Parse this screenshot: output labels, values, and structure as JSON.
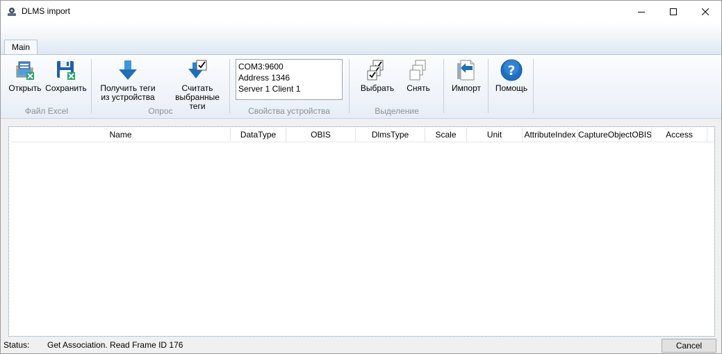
{
  "window": {
    "title": "DLMS import",
    "app_icon": "dlms-app-icon"
  },
  "tabs": [
    {
      "label": "Main",
      "active": true
    }
  ],
  "ribbon": {
    "groups": {
      "excel": {
        "label": "Файл Excel",
        "buttons": [
          {
            "label": "Открыть",
            "icon": "open-excel-icon"
          },
          {
            "label": "Сохранить",
            "icon": "save-excel-icon"
          }
        ]
      },
      "poll": {
        "label": "Опрос",
        "buttons": [
          {
            "line1": "Получить теги",
            "line2": "из устройства",
            "icon": "download-arrow-icon"
          },
          {
            "line1": "Считать",
            "line2": "выбранные теги",
            "icon": "read-selected-icon"
          }
        ]
      },
      "device": {
        "label": "Свойства устройства",
        "lines": [
          "COM3:9600",
          "Address 1346",
          "Server 1 Client 1"
        ]
      },
      "selection": {
        "label": "Выделение",
        "buttons": [
          {
            "label": "Выбрать",
            "icon": "select-all-icon"
          },
          {
            "label": "Снять",
            "icon": "deselect-icon"
          }
        ]
      },
      "import": {
        "buttons": [
          {
            "label": "Импорт",
            "icon": "import-icon"
          }
        ]
      },
      "help": {
        "buttons": [
          {
            "label": "Помощь",
            "icon": "help-icon"
          }
        ]
      }
    }
  },
  "grid": {
    "columns": [
      "Name",
      "DataType",
      "OBIS",
      "DlmsType",
      "Scale",
      "Unit",
      "AttributeIndex",
      "CaptureObjectOBIS",
      "Access"
    ],
    "rows": []
  },
  "status": {
    "label": "Status:",
    "text": "Get Association. Read Frame ID 176",
    "cancel_label": "Cancel"
  },
  "colors": {
    "accent_blue": "#1e6fb5",
    "help_blue": "#1d6fc4",
    "excel_green": "#21a366"
  }
}
